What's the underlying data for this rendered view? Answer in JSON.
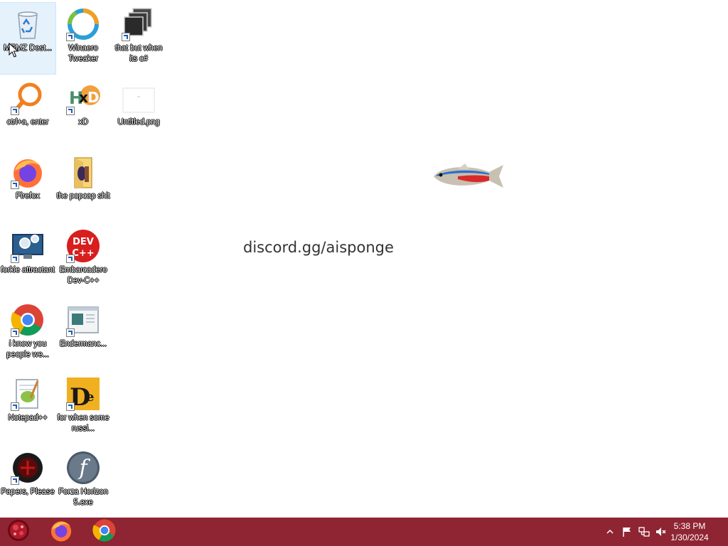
{
  "desktop": {
    "text_overlay": "discord.gg/aisponge",
    "icons": [
      {
        "label": "MEMZ Dest...",
        "icon": "recycle-bin-icon"
      },
      {
        "label": "Winaero Tweaker",
        "icon": "winaero-tweaker-icon"
      },
      {
        "label": "that but when its c#",
        "icon": "stacked-windows-icon"
      },
      {
        "label": "ctrl+a, enter",
        "icon": "magnifier-app-icon"
      },
      {
        "label": "xD",
        "icon": "hxd-icon"
      },
      {
        "label": "Untitled.png",
        "icon": "image-file-icon"
      },
      {
        "label": "Firefox",
        "icon": "firefox-icon"
      },
      {
        "label": "the popcap shit",
        "icon": "folder-icon"
      },
      {
        "label": "forkie attractant",
        "icon": "settings-monitor-icon"
      },
      {
        "label": "Embarcadero Dev-C++",
        "icon": "dev-cpp-icon"
      },
      {
        "label": "i know you people we...",
        "icon": "chrome-icon"
      },
      {
        "label": "Endermanc...",
        "icon": "window-app-icon"
      },
      {
        "label": "Notepad++",
        "icon": "notepadpp-icon"
      },
      {
        "label": "for when some russi...",
        "icon": "de-app-icon"
      },
      {
        "label": "Papers, Please",
        "icon": "papers-please-icon"
      },
      {
        "label": "Forza Horizon 5.exe",
        "icon": "flash-icon"
      }
    ]
  },
  "taskbar": {
    "start_icon": "start-orb-icon",
    "pinned": [
      {
        "name": "firefox",
        "icon": "firefox-icon"
      },
      {
        "name": "chrome",
        "icon": "chrome-icon"
      }
    ],
    "tray": {
      "icons": [
        "show-hidden-icons-chevron",
        "action-center-flag-icon",
        "network-icon",
        "volume-muted-icon"
      ],
      "time": "5:38 PM",
      "date": "1/30/2024"
    }
  },
  "colors": {
    "taskbar": "#8f2432",
    "desktop": "#ffffff"
  }
}
